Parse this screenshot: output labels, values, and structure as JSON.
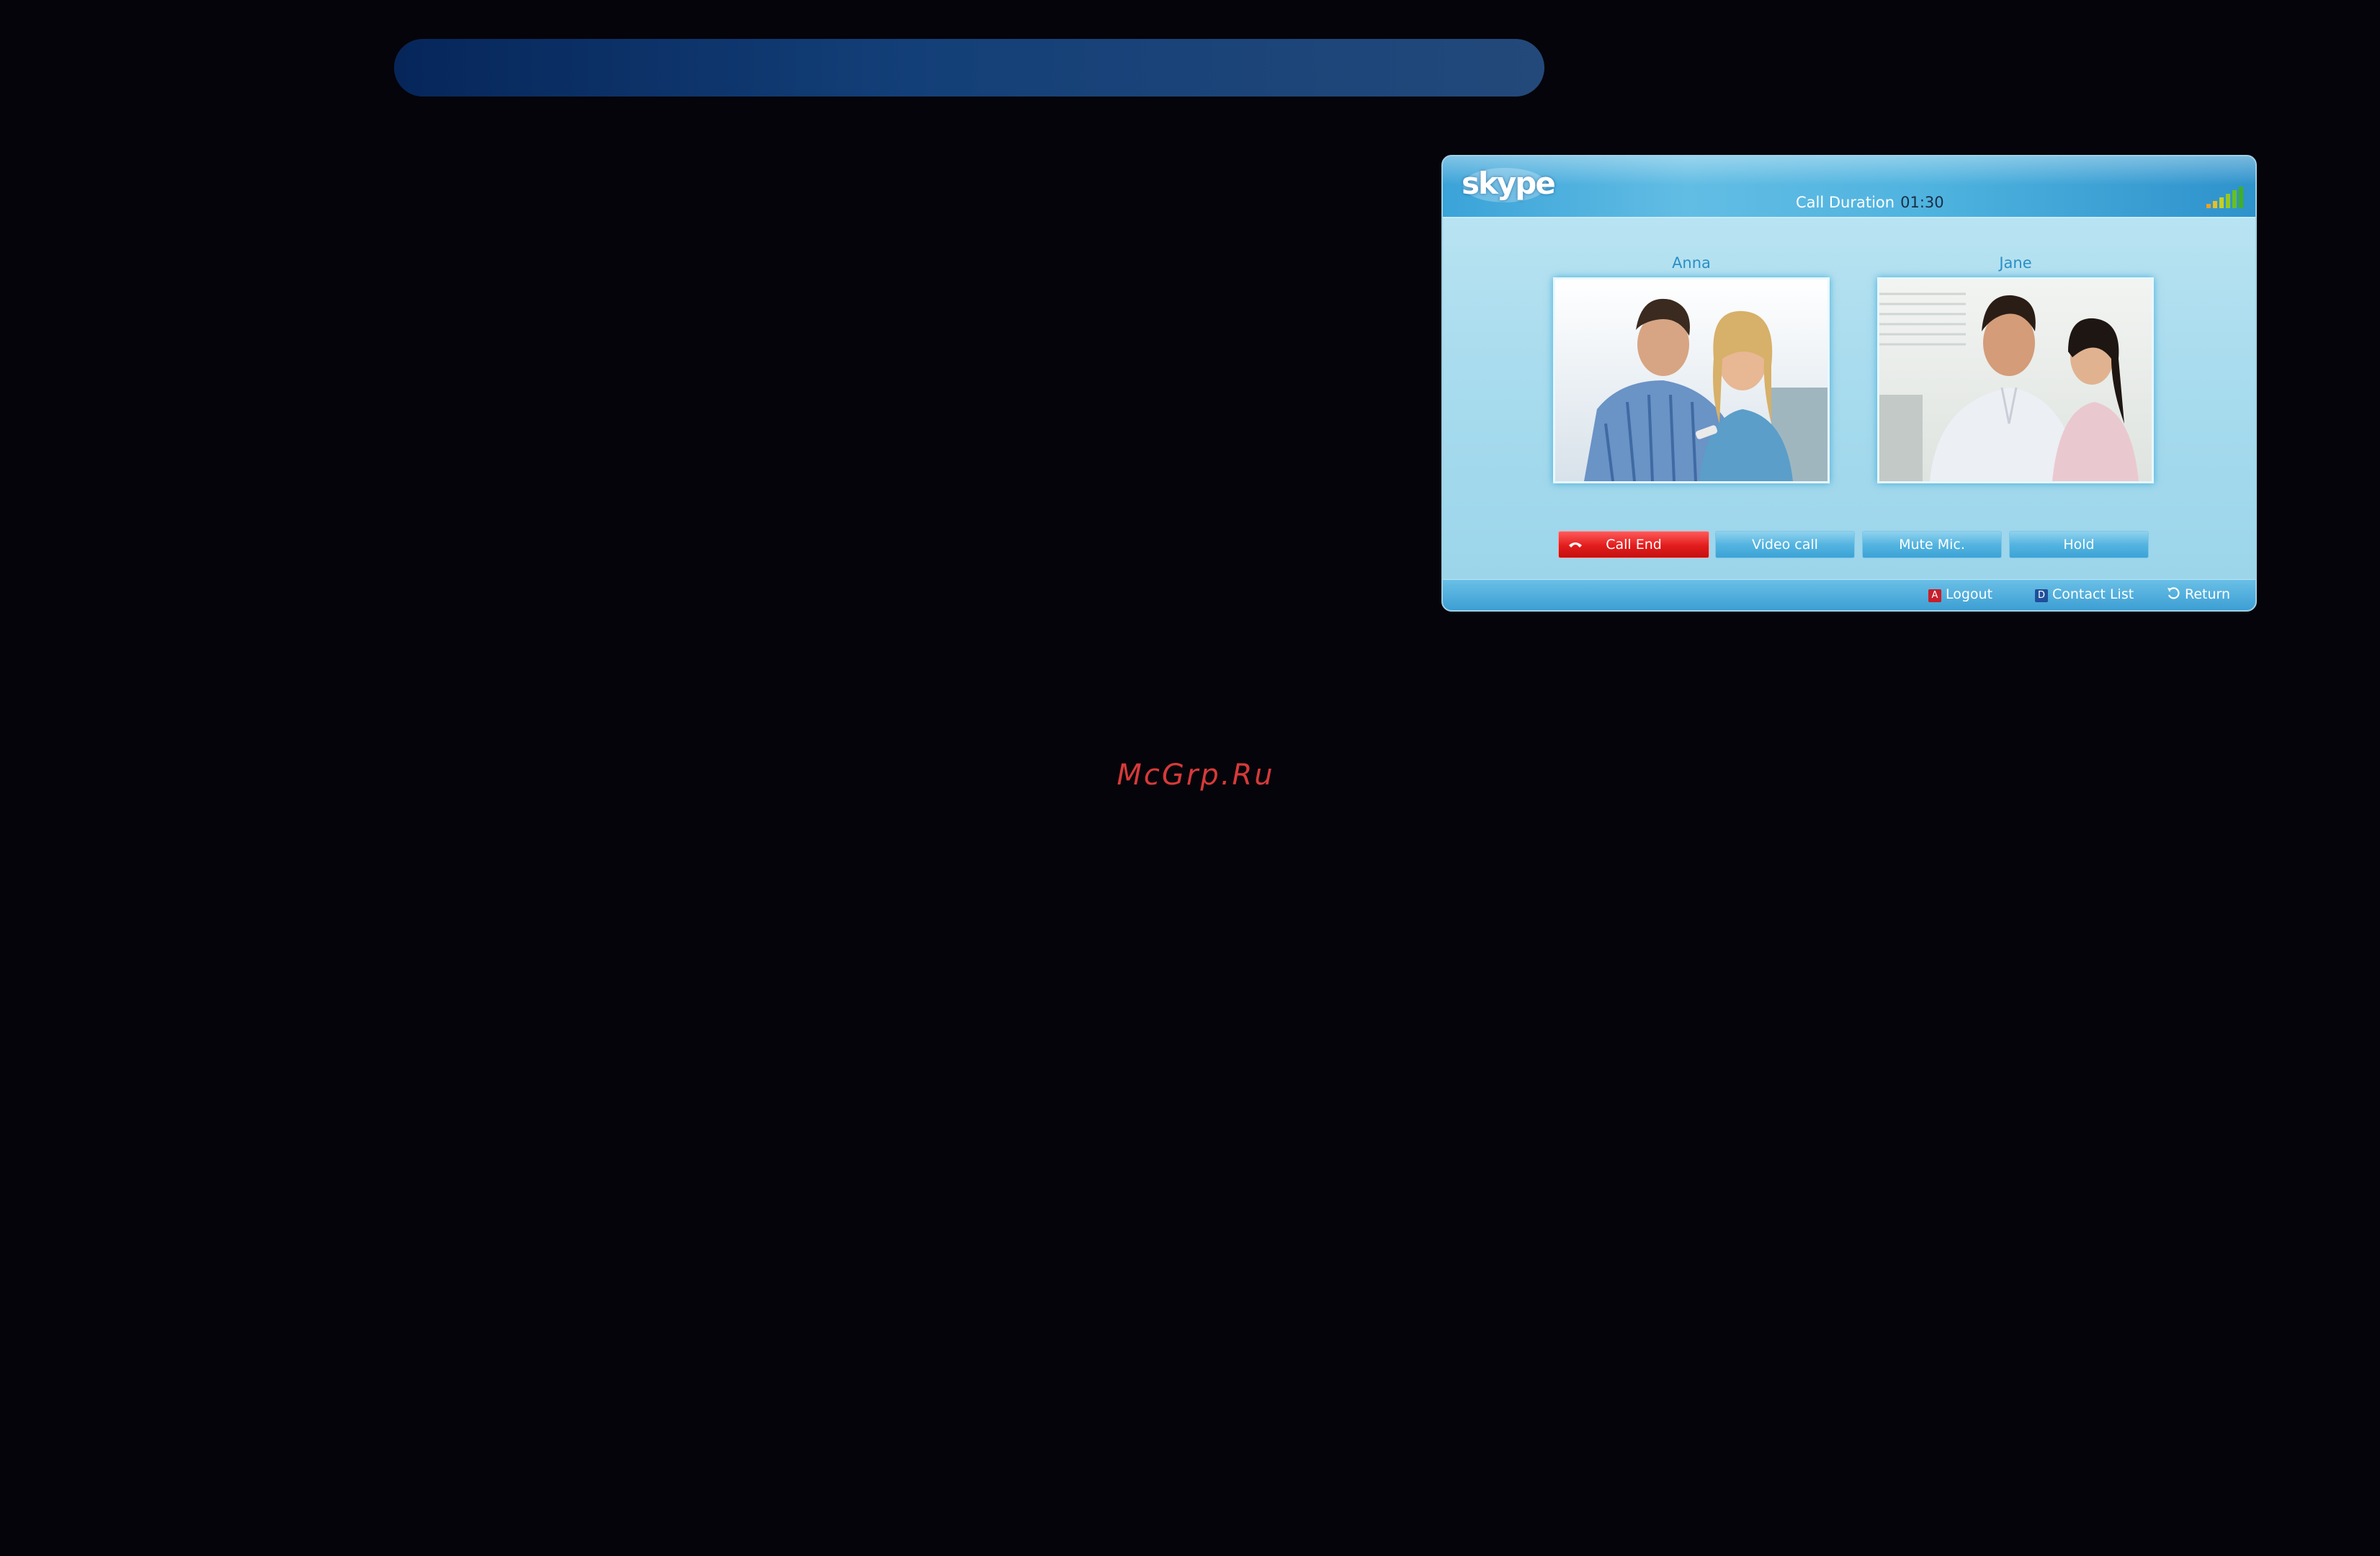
{
  "watermark": "McGrp.Ru",
  "skype": {
    "logo_text": "skype",
    "call_duration_label": "Call Duration",
    "call_duration_value": "01:30",
    "participants": [
      {
        "name": "Anna"
      },
      {
        "name": "Jane"
      }
    ],
    "buttons": {
      "call_end": "Call End",
      "video_call": "Video call",
      "mute_mic": "Mute Mic.",
      "hold": "Hold"
    },
    "footer": {
      "logout_key": "A",
      "logout": "Logout",
      "contact_list_key": "D",
      "contact_list": "Contact List",
      "return": "Return"
    },
    "colors": {
      "call_end": "#e21c1c",
      "accent": "#3ca3d6"
    }
  }
}
